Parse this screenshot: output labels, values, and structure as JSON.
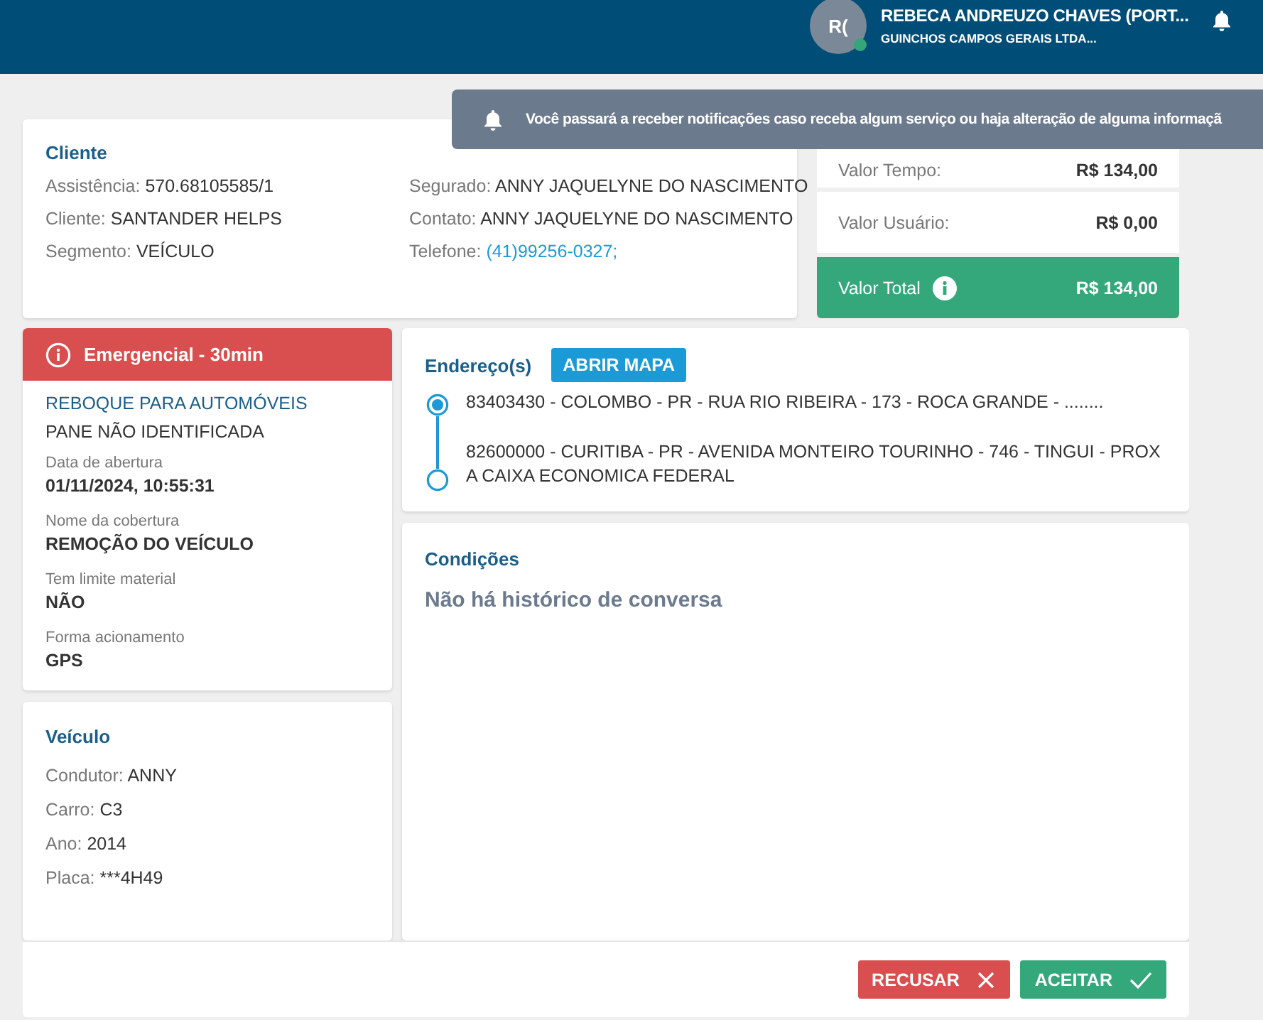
{
  "header": {
    "avatar_initials": "R(",
    "online": true,
    "user_name": "REBECA ANDREUZO CHAVES (PORT...",
    "company": "GUINCHOS CAMPOS GERAIS LTDA..."
  },
  "notification": {
    "message": "Você passará a receber notificações caso receba algum serviço ou haja alteração de alguma informaçã"
  },
  "client": {
    "title": "Cliente",
    "fields": [
      {
        "label": "Assistência:",
        "value": "570.68105585/1",
        "kind": "text"
      },
      {
        "label": "Cliente:",
        "value": "SANTANDER HELPS",
        "kind": "text"
      },
      {
        "label": "Segmento:",
        "value": "VEÍCULO",
        "kind": "text"
      },
      {
        "label": "Segurado:",
        "value": "ANNY JAQUELYNE DO NASCIMENTO",
        "kind": "text"
      },
      {
        "label": "Contato:",
        "value": "ANNY JAQUELYNE DO NASCIMENTO",
        "kind": "text"
      },
      {
        "label": "Telefone:",
        "value": "(41)99256-0327;",
        "kind": "link"
      }
    ]
  },
  "values": [
    {
      "label": "Valor Tempo:",
      "value": "R$ 134,00",
      "kind": "row"
    },
    {
      "label": "Valor Usuário:",
      "value": "R$ 0,00",
      "kind": "row"
    },
    {
      "label": "Valor Total",
      "value": "R$ 134,00",
      "kind": "total"
    }
  ],
  "service": {
    "priority": "Emergencial - 30min",
    "title": "REBOQUE PARA AUTOMÓVEIS",
    "problem": "PANE NÃO IDENTIFICADA",
    "details": [
      {
        "label": "Data de abertura",
        "value": "01/11/2024, 10:55:31"
      },
      {
        "label": "Nome da cobertura",
        "value": "REMOÇÃO DO VEÍCULO"
      },
      {
        "label": "Tem limite material",
        "value": "NÃO"
      },
      {
        "label": "Forma acionamento",
        "value": "GPS"
      }
    ]
  },
  "vehicle": {
    "title": "Veículo",
    "fields": [
      {
        "label": "Condutor:",
        "value": "ANNY"
      },
      {
        "label": "Carro:",
        "value": "C3"
      },
      {
        "label": "Ano:",
        "value": "2014"
      },
      {
        "label": "Placa:",
        "value": "***4H49"
      }
    ]
  },
  "addresses": {
    "title": "Endereço(s)",
    "map_button": "ABRIR MAPA",
    "stops": [
      {
        "text": "83403430 - COLOMBO - PR - RUA RIO RIBEIRA - 173 - ROCA GRANDE - ........",
        "selected": true
      },
      {
        "text": "82600000 - CURITIBA - PR - AVENIDA MONTEIRO TOURINHO - 746 - TINGUI - PROX A CAIXA ECONOMICA FEDERAL",
        "selected": false
      }
    ]
  },
  "conditions": {
    "title": "Condições",
    "empty_message": "Não há histórico de conversa"
  },
  "actions": [
    {
      "label": "RECUSAR",
      "kind": "reject"
    },
    {
      "label": "ACEITAR",
      "kind": "accept"
    }
  ]
}
